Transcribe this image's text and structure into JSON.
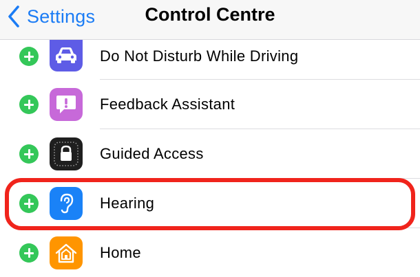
{
  "navbar": {
    "back_label": "Settings",
    "title": "Control Centre"
  },
  "colors": {
    "accent": "#1b7cf5",
    "add_button": "#34c759",
    "highlight": "#f0241c"
  },
  "rows": [
    {
      "label": "Do Not Disturb While Driving",
      "icon": "car-icon",
      "icon_color": "#5e5ce6"
    },
    {
      "label": "Feedback Assistant",
      "icon": "exclamation-bubble-icon",
      "icon_color": "#c769d9"
    },
    {
      "label": "Guided Access",
      "icon": "lock-icon",
      "icon_color": "#1f1f1f"
    },
    {
      "label": "Hearing",
      "icon": "ear-icon",
      "icon_color": "#1a82f7"
    },
    {
      "label": "Home",
      "icon": "house-icon",
      "icon_color": "#ff9500"
    }
  ]
}
